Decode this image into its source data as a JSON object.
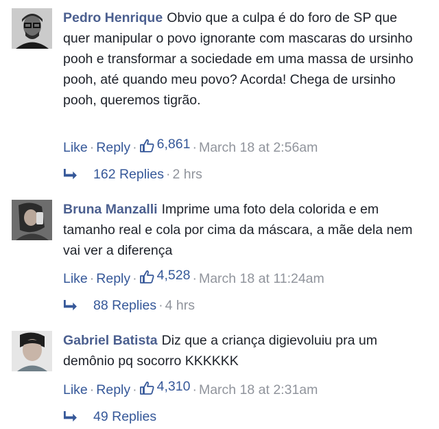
{
  "colors": {
    "name": "#4b5f8f",
    "link": "#365899",
    "meta": "#90949c",
    "text": "#1d2129"
  },
  "comments": [
    {
      "author": "Pedro Henrique",
      "text": "Obvio que a culpa é do foro de SP que quer manipular o povo ignorante com mascaras do ursinho pooh e transformar a sociedade em uma massa de ursinho pooh, até quando meu povo? Acorda! Chega de ursinho pooh, queremos tigrão.",
      "like_label": "Like",
      "reply_label": "Reply",
      "likes": "6,861",
      "timestamp": "March 18 at 2:56am",
      "replies_label": "162 Replies",
      "replies_time": "2 hrs"
    },
    {
      "author": "Bruna Manzalli",
      "text": "Imprime uma foto dela colorida e em tamanho real e cola por cima da máscara, a mãe dela nem vai ver a diferença",
      "like_label": "Like",
      "reply_label": "Reply",
      "likes": "4,528",
      "timestamp": "March 18 at 11:24am",
      "replies_label": "88 Replies",
      "replies_time": "4 hrs"
    },
    {
      "author": "Gabriel Batista",
      "text": "Diz que a criança digievoluiu pra um demônio pq socorro KKKKKK",
      "like_label": "Like",
      "reply_label": "Reply",
      "likes": "4,310",
      "timestamp": "March 18 at 2:31am",
      "replies_label": "49 Replies",
      "replies_time": ""
    }
  ]
}
